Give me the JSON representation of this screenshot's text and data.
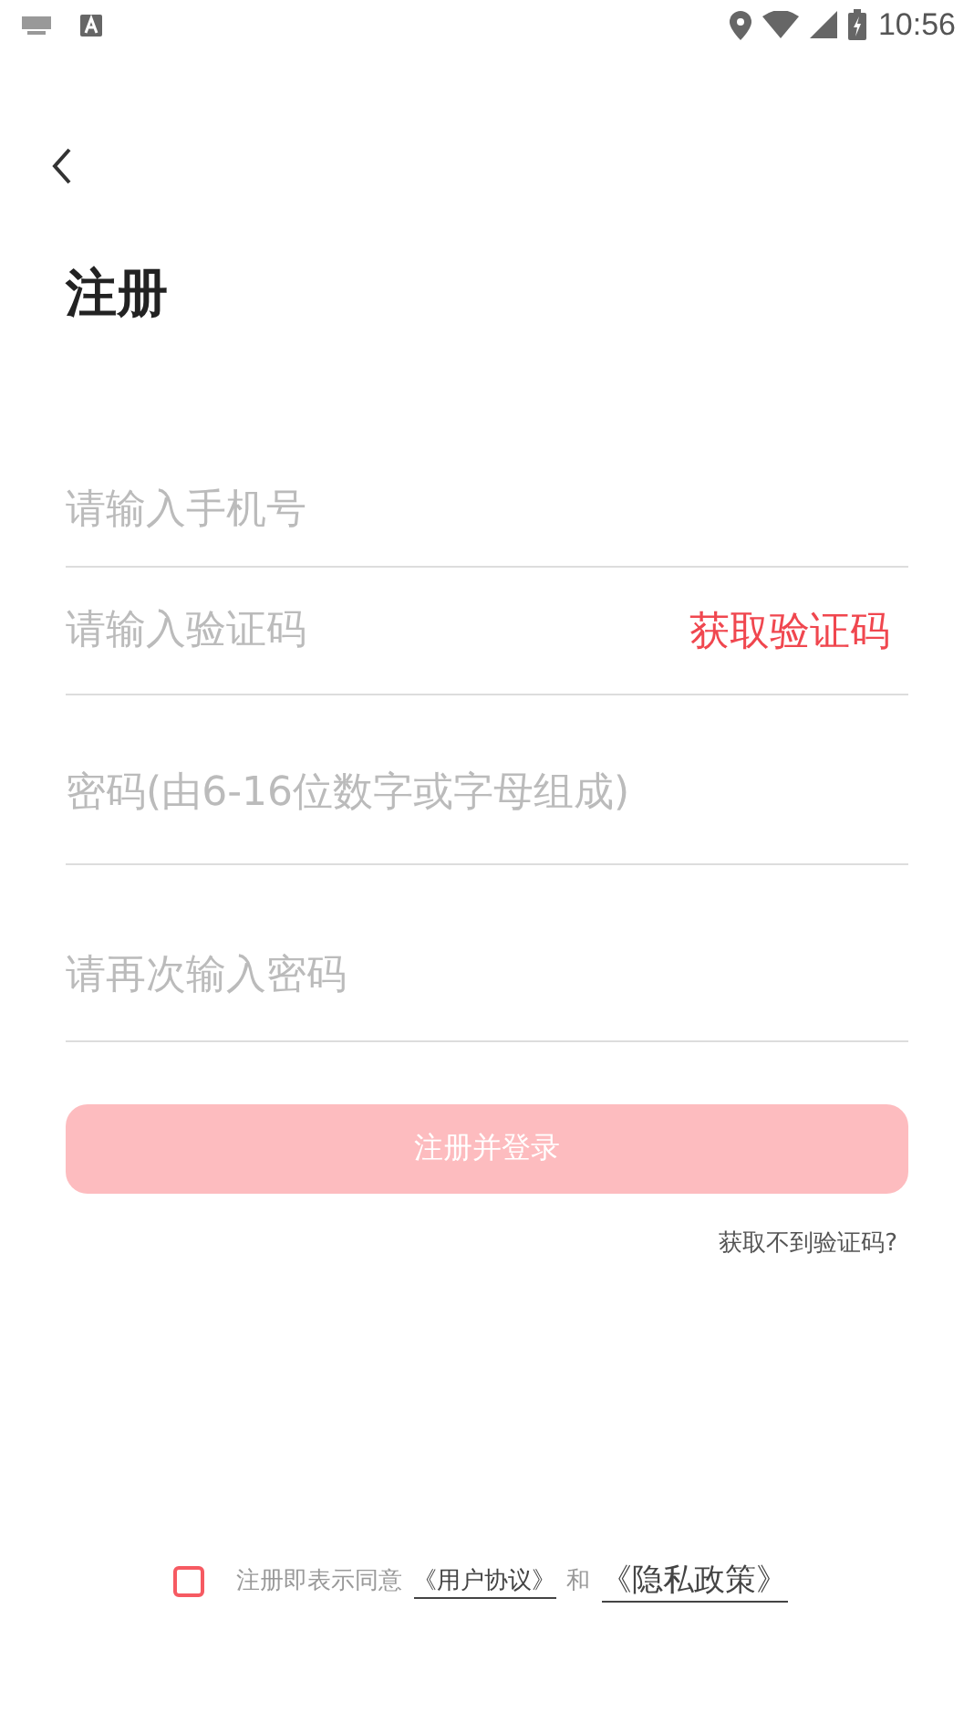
{
  "status_bar": {
    "time": "10:56"
  },
  "title": "注册",
  "fields": [
    {
      "placeholder": "请输入手机号"
    },
    {
      "placeholder": "请输入验证码",
      "action": "获取验证码"
    },
    {
      "placeholder": "密码(由6-16位数字或字母组成)"
    },
    {
      "placeholder": "请再次输入密码"
    }
  ],
  "submit": {
    "label": "注册并登录",
    "disabled": true
  },
  "help_link": "获取不到验证码?",
  "agreement": {
    "checked": false,
    "text": "注册即表示同意",
    "link_1": "《用户协议》",
    "joiner": "和",
    "link_2": "《隐私政策》"
  }
}
